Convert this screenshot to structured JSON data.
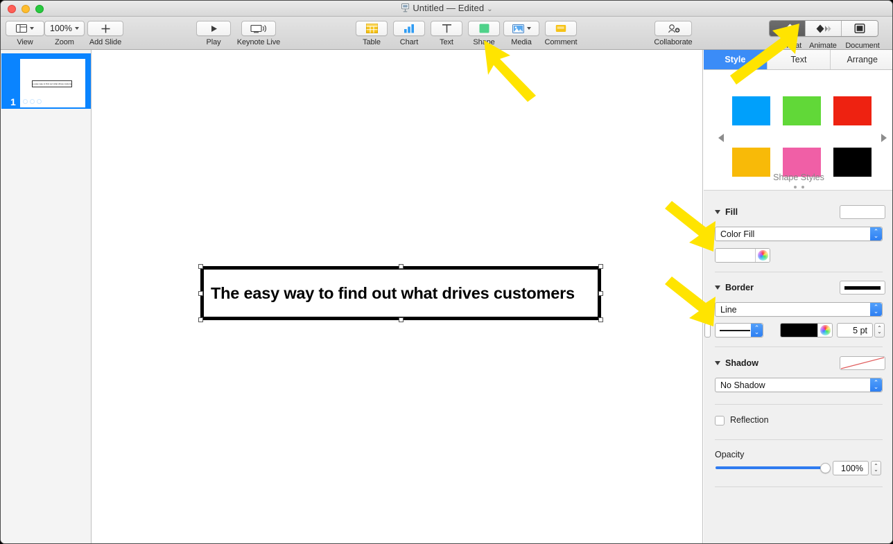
{
  "window": {
    "title": "Untitled — Edited",
    "title_icon": "keynote-document-icon",
    "traffic_lights": [
      "close",
      "minimize",
      "zoom"
    ]
  },
  "toolbar": {
    "view_label": "View",
    "view_icon": "view-layout-icon",
    "zoom_label": "Zoom",
    "zoom_value": "100%",
    "add_slide_label": "Add Slide",
    "add_slide_icon": "plus-icon",
    "play_label": "Play",
    "play_icon": "play-triangle-icon",
    "keynote_live_label": "Keynote Live",
    "keynote_live_icon": "display-broadcast-icon",
    "table_label": "Table",
    "table_icon": "table-grid-icon",
    "chart_label": "Chart",
    "chart_icon": "bar-chart-icon",
    "text_label": "Text",
    "text_icon": "text-t-icon",
    "shape_label": "Shape",
    "shape_icon": "green-square-icon",
    "media_label": "Media",
    "media_icon": "photo-icon",
    "comment_label": "Comment",
    "comment_icon": "comment-flag-icon",
    "collaborate_label": "Collaborate",
    "collaborate_icon": "person-add-icon",
    "format_label": "Format",
    "format_icon": "paintbrush-icon",
    "animate_label": "Animate",
    "animate_icon": "diamond-motion-icon",
    "document_label": "Document",
    "document_icon": "document-square-icon",
    "active_segment": "Format"
  },
  "navigator": {
    "slide_number": "1",
    "thumb_text": "The easy way to find out what drives customers",
    "selected": true
  },
  "canvas": {
    "shape_text": "The easy way to find out what drives customers",
    "selected": true,
    "handle_count": 8
  },
  "inspector": {
    "tabs": [
      {
        "label": "Style",
        "selected": true
      },
      {
        "label": "Text",
        "selected": false
      },
      {
        "label": "Arrange",
        "selected": false
      }
    ],
    "shape_styles": {
      "caption": "Shape Styles",
      "swatches": [
        {
          "name": "blue",
          "color": "#00a0fb"
        },
        {
          "name": "green",
          "color": "#61d838"
        },
        {
          "name": "red",
          "color": "#ee2211"
        },
        {
          "name": "amber",
          "color": "#f8ba08"
        },
        {
          "name": "pink",
          "color": "#f05fa6"
        },
        {
          "name": "black",
          "color": "#000000"
        }
      ],
      "page_dots": 2,
      "prev_arrow_icon": "chevron-left-icon",
      "next_arrow_icon": "chevron-right-icon"
    },
    "fill": {
      "title": "Fill",
      "type_value": "Color Fill",
      "color_value": "#ffffff",
      "preview_color": "#ffffff",
      "color_wheel_icon": "color-wheel-icon"
    },
    "border": {
      "title": "Border",
      "type_value": "Line",
      "preview_color": "#000000",
      "line_style_icon": "solid-line-icon",
      "color_value": "#000000",
      "width_value": "5 pt",
      "color_wheel_icon": "color-wheel-icon"
    },
    "shadow": {
      "title": "Shadow",
      "type_value": "No Shadow",
      "preview_icon": "no-shadow-slash-icon",
      "preview_slash_color": "#e05c5c"
    },
    "reflection": {
      "label": "Reflection",
      "checked": false
    },
    "opacity": {
      "label": "Opacity",
      "value": "100%",
      "percent": 100,
      "track_color": "#2f7bf0"
    }
  },
  "annotations": {
    "arrow_color": "#ffe400",
    "arrows": [
      {
        "name": "arrow-to-shape-button",
        "target": "Shape"
      },
      {
        "name": "arrow-to-format-button",
        "target": "Format"
      },
      {
        "name": "arrow-to-fill-color",
        "target": "Fill color well"
      },
      {
        "name": "arrow-to-border-type",
        "target": "Border Line popup"
      }
    ]
  }
}
